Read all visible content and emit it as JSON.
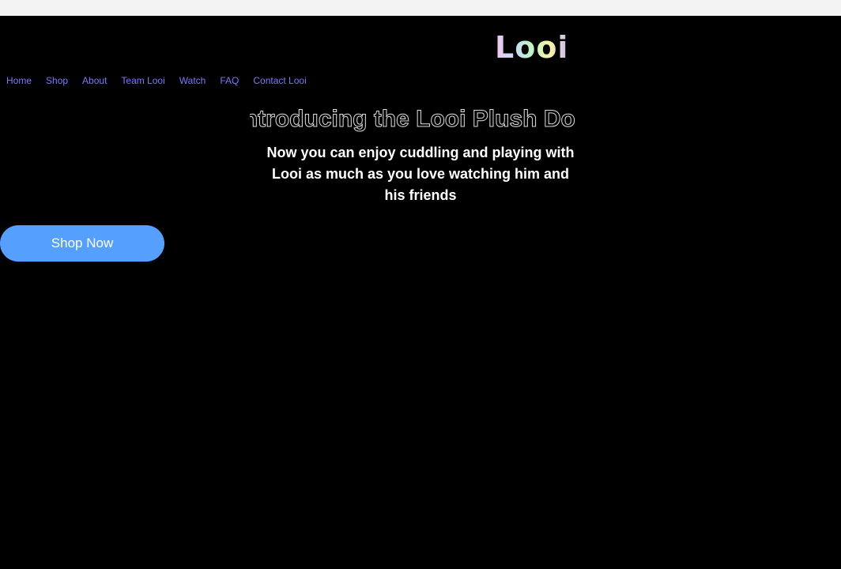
{
  "brand": {
    "logo_text": "Looi"
  },
  "nav": {
    "items": [
      "Home",
      "Shop",
      "About",
      "Team Looi",
      "Watch",
      "FAQ",
      "Contact Looi"
    ]
  },
  "hero": {
    "title": "Introducing the Looi Plush Doll",
    "subtitle": "Now you can enjoy cuddling and playing with Looi as much as you love watching him and his friends",
    "cta": "Shop Now"
  },
  "colors": {
    "background": "#000000",
    "nav_link": "#7a7aff",
    "cta": "#55a0ff"
  }
}
